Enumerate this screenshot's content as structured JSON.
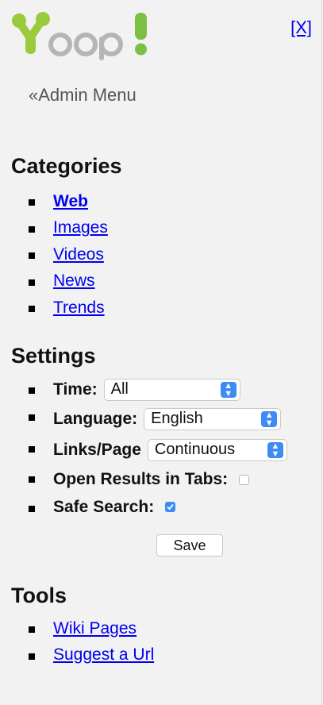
{
  "logo": {
    "text": "Yoop!"
  },
  "close_label": "[X]",
  "admin_menu": "«Admin Menu",
  "categories": {
    "heading": "Categories",
    "items": [
      {
        "label": "Web",
        "active": true
      },
      {
        "label": "Images"
      },
      {
        "label": "Videos"
      },
      {
        "label": "News"
      },
      {
        "label": "Trends"
      }
    ]
  },
  "settings": {
    "heading": "Settings",
    "time": {
      "label": "Time:",
      "value": "All"
    },
    "language": {
      "label": "Language:",
      "value": "English"
    },
    "links_page": {
      "label": "Links/Page",
      "value": "Continuous"
    },
    "open_tabs": {
      "label": "Open Results in Tabs:",
      "checked": false
    },
    "safe_search": {
      "label": "Safe Search:",
      "checked": true
    },
    "save_label": "Save"
  },
  "tools": {
    "heading": "Tools",
    "items": [
      {
        "label": "Wiki Pages"
      },
      {
        "label": "Suggest a Url"
      }
    ]
  },
  "colors": {
    "link": "#0000ee",
    "accent": "#3b8cf5",
    "logo_green": "#8bc34a",
    "logo_gray": "#b3b3b3"
  }
}
